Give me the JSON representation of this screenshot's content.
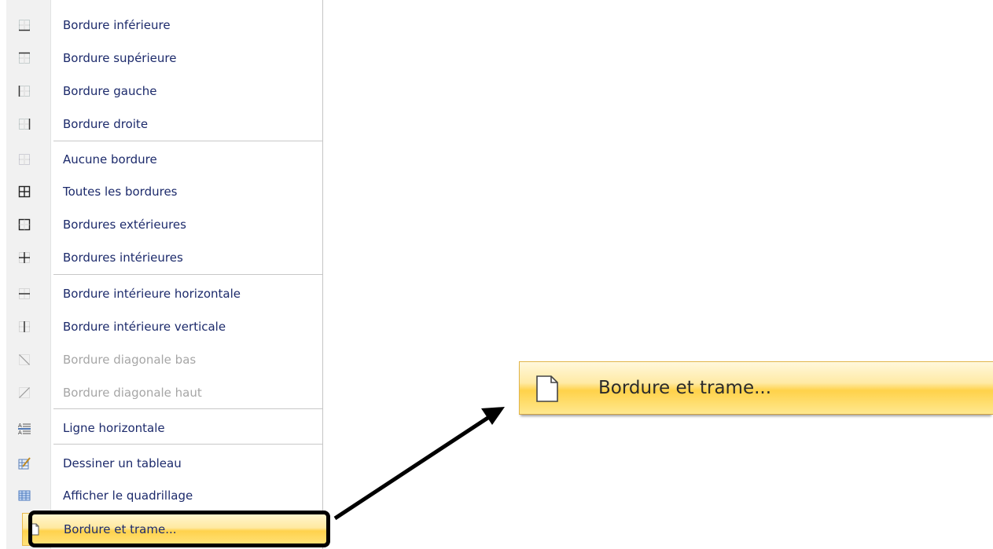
{
  "menu": {
    "items": [
      {
        "label": "Bordure inférieure",
        "icon": "border-bottom-icon",
        "disabled": false
      },
      {
        "label": "Bordure supérieure",
        "icon": "border-top-icon",
        "disabled": false
      },
      {
        "label": "Bordure gauche",
        "icon": "border-left-icon",
        "disabled": false
      },
      {
        "label": "Bordure droite",
        "icon": "border-right-icon",
        "disabled": false
      },
      {
        "label": "Aucune bordure",
        "icon": "no-border-icon",
        "disabled": false
      },
      {
        "label": "Toutes les bordures",
        "icon": "all-borders-icon",
        "disabled": false
      },
      {
        "label": "Bordures extérieures",
        "icon": "outside-borders-icon",
        "disabled": false
      },
      {
        "label": "Bordures intérieures",
        "icon": "inside-borders-icon",
        "disabled": false
      },
      {
        "label": "Bordure intérieure horizontale",
        "icon": "inside-horizontal-border-icon",
        "disabled": false
      },
      {
        "label": "Bordure intérieure verticale",
        "icon": "inside-vertical-border-icon",
        "disabled": false
      },
      {
        "label": "Bordure diagonale bas",
        "icon": "diagonal-down-border-icon",
        "disabled": true
      },
      {
        "label": "Bordure diagonale haut",
        "icon": "diagonal-up-border-icon",
        "disabled": true
      },
      {
        "label": "Ligne horizontale",
        "icon": "horizontal-line-icon",
        "disabled": false
      },
      {
        "label": "Dessiner un tableau",
        "icon": "draw-table-icon",
        "disabled": false
      },
      {
        "label": "Afficher le quadrillage",
        "icon": "view-gridlines-icon",
        "disabled": false
      },
      {
        "label": "Bordure et trame...",
        "icon": "page-icon",
        "disabled": false,
        "highlighted": true
      }
    ]
  },
  "zoomed_item": {
    "label": "Bordure et trame...",
    "icon": "page-icon"
  },
  "colors": {
    "highlight": "#ffd24d",
    "label_text": "#1c2a6b",
    "disabled_text": "#a6a6a6",
    "callout": "#000000"
  }
}
